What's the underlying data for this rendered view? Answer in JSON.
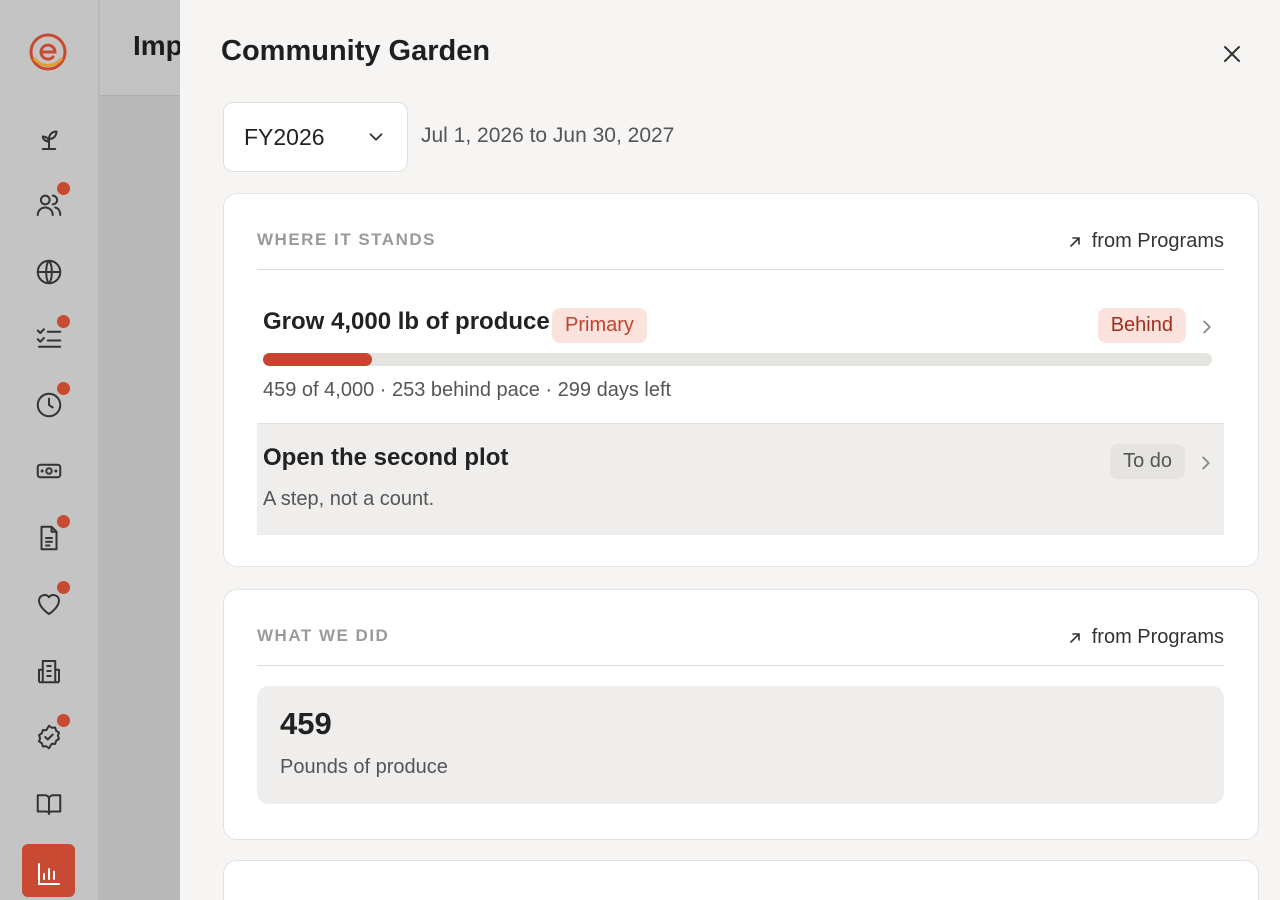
{
  "app": {
    "page_title": "Imp",
    "nav": [
      {
        "icon": "sprout-icon",
        "badge": false
      },
      {
        "icon": "users-icon",
        "badge": true
      },
      {
        "icon": "globe-icon",
        "badge": false
      },
      {
        "icon": "checklist-icon",
        "badge": true
      },
      {
        "icon": "clock-icon",
        "badge": true
      },
      {
        "icon": "money-icon",
        "badge": false
      },
      {
        "icon": "document-icon",
        "badge": true
      },
      {
        "icon": "heart-icon",
        "badge": true
      },
      {
        "icon": "building-icon",
        "badge": false
      },
      {
        "icon": "badge-check-icon",
        "badge": true
      },
      {
        "icon": "book-icon",
        "badge": false
      },
      {
        "icon": "chart-icon",
        "badge": false,
        "active": true
      }
    ],
    "accent_color": "#c84a32"
  },
  "drawer": {
    "title": "Community Garden",
    "period": {
      "selected": "FY2026",
      "range": "Jul 1, 2026 to Jun 30, 2027"
    },
    "where_it_stands": {
      "label": "WHERE IT STANDS",
      "link": "from Programs",
      "goal": {
        "title": "Grow 4,000 lb of produce",
        "tag": "Primary",
        "status": "Behind",
        "progress": 0.1148,
        "subtitle": "459 of 4,000 · 253 behind pace · 299 days left"
      },
      "step": {
        "title": "Open the second plot",
        "subtitle": "A step, not a count.",
        "status": "To do"
      }
    },
    "what_we_did": {
      "label": "WHAT WE DID",
      "link": "from Programs",
      "metric": {
        "value": "459",
        "label": "Pounds of produce"
      }
    }
  }
}
